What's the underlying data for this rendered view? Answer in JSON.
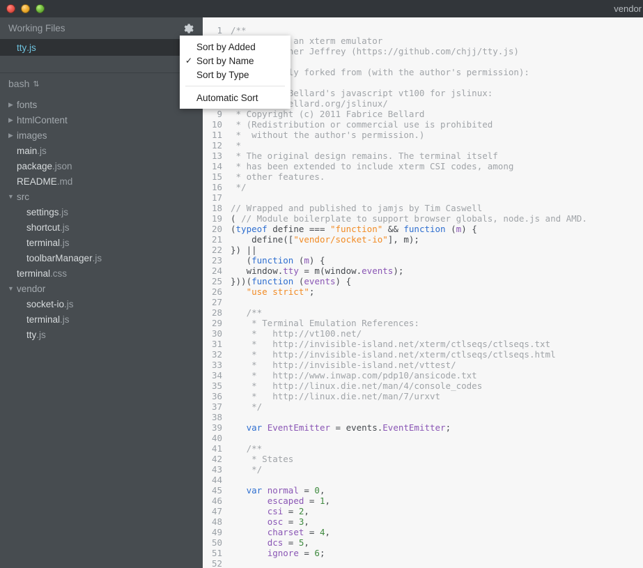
{
  "window": {
    "title": "vendor",
    "controls": [
      "close-button",
      "minimize-button",
      "zoom-button"
    ]
  },
  "sidebar": {
    "working_files": {
      "header": "Working Files",
      "gear_icon": "gear-icon",
      "items": [
        {
          "name": "tty",
          "ext": ".js",
          "selected": true
        }
      ]
    },
    "context_selector": {
      "label": "bash",
      "arrows": "⇅"
    },
    "tree": [
      {
        "name": "fonts",
        "ext": "",
        "type": "folder",
        "depth": 0,
        "expanded": false
      },
      {
        "name": "htmlContent",
        "ext": "",
        "type": "folder",
        "depth": 0,
        "expanded": false
      },
      {
        "name": "images",
        "ext": "",
        "type": "folder",
        "depth": 0,
        "expanded": false
      },
      {
        "name": "main",
        "ext": ".js",
        "type": "file",
        "depth": 0
      },
      {
        "name": "package",
        "ext": ".json",
        "type": "file",
        "depth": 0
      },
      {
        "name": "README",
        "ext": ".md",
        "type": "file",
        "depth": 0
      },
      {
        "name": "src",
        "ext": "",
        "type": "folder",
        "depth": 0,
        "expanded": true
      },
      {
        "name": "settings",
        "ext": ".js",
        "type": "file",
        "depth": 1
      },
      {
        "name": "shortcut",
        "ext": ".js",
        "type": "file",
        "depth": 1
      },
      {
        "name": "terminal",
        "ext": ".js",
        "type": "file",
        "depth": 1
      },
      {
        "name": "toolbarManager",
        "ext": ".js",
        "type": "file",
        "depth": 1
      },
      {
        "name": "terminal",
        "ext": ".css",
        "type": "file",
        "depth": 0
      },
      {
        "name": "vendor",
        "ext": "",
        "type": "folder",
        "depth": 0,
        "expanded": true
      },
      {
        "name": "socket-io",
        "ext": ".js",
        "type": "file",
        "depth": 1
      },
      {
        "name": "terminal",
        "ext": ".js",
        "type": "file",
        "depth": 1
      },
      {
        "name": "tty",
        "ext": ".js",
        "type": "file",
        "depth": 1
      }
    ]
  },
  "sort_menu": {
    "items": [
      {
        "label": "Sort by Added",
        "checked": false
      },
      {
        "label": "Sort by Name",
        "checked": true
      },
      {
        "label": "Sort by Type",
        "checked": false
      }
    ],
    "separator": true,
    "footer_items": [
      {
        "label": "Automatic Sort",
        "checked": false
      }
    ]
  },
  "editor": {
    "first_line": 1,
    "lines": [
      {
        "n": 1,
        "tokens": [
          {
            "t": "/**",
            "c": "cm"
          }
        ]
      },
      {
        "n": 2,
        "tokens": [
          {
            "t": " * tty.js - an xterm emulator",
            "c": "cm"
          }
        ]
      },
      {
        "n": 3,
        "tokens": [
          {
            "t": " * Christopher Jeffrey (https://github.com/chjj/tty.js)",
            "c": "cm"
          }
        ]
      },
      {
        "n": 4,
        "tokens": [
          {
            "t": " *",
            "c": "cm"
          }
        ]
      },
      {
        "n": 5,
        "tokens": [
          {
            "t": " * Originally forked from (with the author's permission):",
            "c": "cm"
          }
        ]
      },
      {
        "n": 6,
        "tokens": [
          {
            "t": " *",
            "c": "cm"
          }
        ]
      },
      {
        "n": 7,
        "tokens": [
          {
            "t": " * Fabrice Bellard's javascript vt100 for jslinux:",
            "c": "cm"
          }
        ]
      },
      {
        "n": 8,
        "tokens": [
          {
            "t": " * http://bellard.org/jslinux/",
            "c": "cm"
          }
        ]
      },
      {
        "n": 9,
        "tokens": [
          {
            "t": " * Copyright (c) 2011 Fabrice Bellard",
            "c": "cm"
          }
        ]
      },
      {
        "n": 10,
        "tokens": [
          {
            "t": " * (Redistribution or commercial use is prohibited",
            "c": "cm"
          }
        ]
      },
      {
        "n": 11,
        "tokens": [
          {
            "t": " *  without the author's permission.)",
            "c": "cm"
          }
        ]
      },
      {
        "n": 12,
        "tokens": [
          {
            "t": " *",
            "c": "cm"
          }
        ]
      },
      {
        "n": 13,
        "tokens": [
          {
            "t": " * The original design remains. The terminal itself",
            "c": "cm"
          }
        ]
      },
      {
        "n": 14,
        "tokens": [
          {
            "t": " * has been extended to include xterm CSI codes, among",
            "c": "cm"
          }
        ]
      },
      {
        "n": 15,
        "tokens": [
          {
            "t": " * other features.",
            "c": "cm"
          }
        ]
      },
      {
        "n": 16,
        "tokens": [
          {
            "t": " */",
            "c": "cm"
          }
        ]
      },
      {
        "n": 17,
        "tokens": []
      },
      {
        "n": 18,
        "tokens": [
          {
            "t": "// Wrapped and published to jamjs by Tim Caswell",
            "c": "cm"
          }
        ]
      },
      {
        "n": 19,
        "tokens": [
          {
            "t": "( ",
            "c": "ctext"
          },
          {
            "t": "// Module boilerplate to support browser globals, node.js and AMD.",
            "c": "cm"
          }
        ]
      },
      {
        "n": 20,
        "tokens": [
          {
            "t": "(",
            "c": "ctext"
          },
          {
            "t": "typeof",
            "c": "kw"
          },
          {
            "t": " define === ",
            "c": "ctext"
          },
          {
            "t": "\"function\"",
            "c": "str"
          },
          {
            "t": " && ",
            "c": "ctext"
          },
          {
            "t": "function",
            "c": "kw"
          },
          {
            "t": " (",
            "c": "ctext"
          },
          {
            "t": "m",
            "c": "var"
          },
          {
            "t": ") {",
            "c": "ctext"
          }
        ]
      },
      {
        "n": 21,
        "tokens": [
          {
            "t": "    define([",
            "c": "ctext"
          },
          {
            "t": "\"vendor/socket-io\"",
            "c": "str"
          },
          {
            "t": "], m);",
            "c": "ctext"
          }
        ]
      },
      {
        "n": 22,
        "tokens": [
          {
            "t": "}) ||",
            "c": "ctext"
          }
        ]
      },
      {
        "n": 23,
        "tokens": [
          {
            "t": "   (",
            "c": "ctext"
          },
          {
            "t": "function",
            "c": "kw"
          },
          {
            "t": " (",
            "c": "ctext"
          },
          {
            "t": "m",
            "c": "var"
          },
          {
            "t": ") {",
            "c": "ctext"
          }
        ]
      },
      {
        "n": 24,
        "tokens": [
          {
            "t": "   window.",
            "c": "ctext"
          },
          {
            "t": "tty",
            "c": "var"
          },
          {
            "t": " = m(window.",
            "c": "ctext"
          },
          {
            "t": "events",
            "c": "var"
          },
          {
            "t": ");",
            "c": "ctext"
          }
        ]
      },
      {
        "n": 25,
        "tokens": [
          {
            "t": "}))(",
            "c": "ctext"
          },
          {
            "t": "function",
            "c": "kw"
          },
          {
            "t": " (",
            "c": "ctext"
          },
          {
            "t": "events",
            "c": "var"
          },
          {
            "t": ") {",
            "c": "ctext"
          }
        ]
      },
      {
        "n": 26,
        "tokens": [
          {
            "t": "   ",
            "c": "ctext"
          },
          {
            "t": "\"use strict\"",
            "c": "str"
          },
          {
            "t": ";",
            "c": "ctext"
          }
        ]
      },
      {
        "n": 27,
        "tokens": []
      },
      {
        "n": 28,
        "tokens": [
          {
            "t": "   /**",
            "c": "cm"
          }
        ]
      },
      {
        "n": 29,
        "tokens": [
          {
            "t": "    * Terminal Emulation References:",
            "c": "cm"
          }
        ]
      },
      {
        "n": 30,
        "tokens": [
          {
            "t": "    *   http://vt100.net/",
            "c": "cm"
          }
        ]
      },
      {
        "n": 31,
        "tokens": [
          {
            "t": "    *   http://invisible-island.net/xterm/ctlseqs/ctlseqs.txt",
            "c": "cm"
          }
        ]
      },
      {
        "n": 32,
        "tokens": [
          {
            "t": "    *   http://invisible-island.net/xterm/ctlseqs/ctlseqs.html",
            "c": "cm"
          }
        ]
      },
      {
        "n": 33,
        "tokens": [
          {
            "t": "    *   http://invisible-island.net/vttest/",
            "c": "cm"
          }
        ]
      },
      {
        "n": 34,
        "tokens": [
          {
            "t": "    *   http://www.inwap.com/pdp10/ansicode.txt",
            "c": "cm"
          }
        ]
      },
      {
        "n": 35,
        "tokens": [
          {
            "t": "    *   http://linux.die.net/man/4/console_codes",
            "c": "cm"
          }
        ]
      },
      {
        "n": 36,
        "tokens": [
          {
            "t": "    *   http://linux.die.net/man/7/urxvt",
            "c": "cm"
          }
        ]
      },
      {
        "n": 37,
        "tokens": [
          {
            "t": "    */",
            "c": "cm"
          }
        ]
      },
      {
        "n": 38,
        "tokens": []
      },
      {
        "n": 39,
        "tokens": [
          {
            "t": "   ",
            "c": "ctext"
          },
          {
            "t": "var",
            "c": "kw"
          },
          {
            "t": " ",
            "c": "ctext"
          },
          {
            "t": "EventEmitter",
            "c": "var"
          },
          {
            "t": " = events.",
            "c": "ctext"
          },
          {
            "t": "EventEmitter",
            "c": "var"
          },
          {
            "t": ";",
            "c": "ctext"
          }
        ]
      },
      {
        "n": 40,
        "tokens": []
      },
      {
        "n": 41,
        "tokens": [
          {
            "t": "   /**",
            "c": "cm"
          }
        ]
      },
      {
        "n": 42,
        "tokens": [
          {
            "t": "    * States",
            "c": "cm"
          }
        ]
      },
      {
        "n": 43,
        "tokens": [
          {
            "t": "    */",
            "c": "cm"
          }
        ]
      },
      {
        "n": 44,
        "tokens": []
      },
      {
        "n": 45,
        "tokens": [
          {
            "t": "   ",
            "c": "ctext"
          },
          {
            "t": "var",
            "c": "kw"
          },
          {
            "t": " ",
            "c": "ctext"
          },
          {
            "t": "normal",
            "c": "var"
          },
          {
            "t": " = ",
            "c": "ctext"
          },
          {
            "t": "0",
            "c": "num"
          },
          {
            "t": ",",
            "c": "ctext"
          }
        ]
      },
      {
        "n": 46,
        "tokens": [
          {
            "t": "       ",
            "c": "ctext"
          },
          {
            "t": "escaped",
            "c": "var"
          },
          {
            "t": " = ",
            "c": "ctext"
          },
          {
            "t": "1",
            "c": "num"
          },
          {
            "t": ",",
            "c": "ctext"
          }
        ]
      },
      {
        "n": 47,
        "tokens": [
          {
            "t": "       ",
            "c": "ctext"
          },
          {
            "t": "csi",
            "c": "var"
          },
          {
            "t": " = ",
            "c": "ctext"
          },
          {
            "t": "2",
            "c": "num"
          },
          {
            "t": ",",
            "c": "ctext"
          }
        ]
      },
      {
        "n": 48,
        "tokens": [
          {
            "t": "       ",
            "c": "ctext"
          },
          {
            "t": "osc",
            "c": "var"
          },
          {
            "t": " = ",
            "c": "ctext"
          },
          {
            "t": "3",
            "c": "num"
          },
          {
            "t": ",",
            "c": "ctext"
          }
        ]
      },
      {
        "n": 49,
        "tokens": [
          {
            "t": "       ",
            "c": "ctext"
          },
          {
            "t": "charset",
            "c": "var"
          },
          {
            "t": " = ",
            "c": "ctext"
          },
          {
            "t": "4",
            "c": "num"
          },
          {
            "t": ",",
            "c": "ctext"
          }
        ]
      },
      {
        "n": 50,
        "tokens": [
          {
            "t": "       ",
            "c": "ctext"
          },
          {
            "t": "dcs",
            "c": "var"
          },
          {
            "t": " = ",
            "c": "ctext"
          },
          {
            "t": "5",
            "c": "num"
          },
          {
            "t": ",",
            "c": "ctext"
          }
        ]
      },
      {
        "n": 51,
        "tokens": [
          {
            "t": "       ",
            "c": "ctext"
          },
          {
            "t": "ignore",
            "c": "var"
          },
          {
            "t": " = ",
            "c": "ctext"
          },
          {
            "t": "6",
            "c": "num"
          },
          {
            "t": ";",
            "c": "ctext"
          }
        ]
      },
      {
        "n": 52,
        "tokens": []
      }
    ]
  },
  "colors": {
    "titlebar_bg": "#32363a",
    "sidebar_bg": "#474c50",
    "selected_row_bg": "#2e3134",
    "selected_text": "#6fc3df",
    "editor_bg": "#f7f7f7",
    "comment": "#a0a4a8",
    "keyword": "#2f6fd0",
    "string": "#f28b24",
    "variable": "#8a56b5",
    "number": "#3f8a3f"
  }
}
